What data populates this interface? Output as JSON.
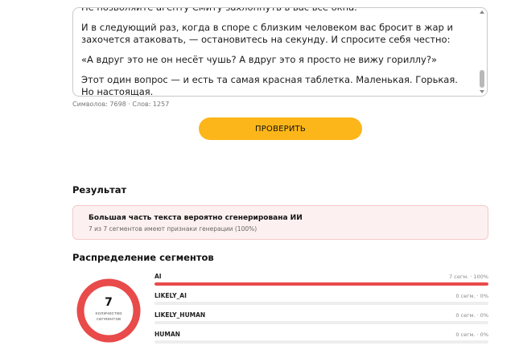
{
  "editor": {
    "lines": [
      "Не позволяйте агенту Смиту захлопнуть в вас все окна.",
      "И в следующий раз, когда в споре с близким человеком вас бросит в жар и захочется атаковать, — остановитесь на секунду. И спросите себя честно:",
      "«А вдруг это не он несёт чушь? А вдруг это я просто не вижу гориллу?»",
      "Этот один вопрос — и есть та самая красная таблетка. Маленькая. Горькая. Но настоящая."
    ]
  },
  "stats": {
    "text": "Символов: 7698 · Слов: 1257"
  },
  "check_button": {
    "label": "ПРОВЕРИТЬ"
  },
  "result": {
    "title": "Результат",
    "verdict": "Большая часть текста вероятно сгенерирована ИИ",
    "detail": "7 из 7 сегментов имеют признаки генерации (100%)"
  },
  "distribution": {
    "title": "Распределение сегментов",
    "total": "7",
    "caption_line1": "количество",
    "caption_line2": "сегментов",
    "ring_fraction": 1.0,
    "ring_color": "#e94a4a",
    "segments": [
      {
        "label": "AI",
        "value": "7 сегм. · 100%",
        "fraction": 1.0
      },
      {
        "label": "LIKELY_AI",
        "value": "0 сегм. · 0%",
        "fraction": 0
      },
      {
        "label": "LIKELY_HUMAN",
        "value": "0 сегм. · 0%",
        "fraction": 0
      },
      {
        "label": "HUMAN",
        "value": "0 сегм. · 0%",
        "fraction": 0
      }
    ]
  }
}
